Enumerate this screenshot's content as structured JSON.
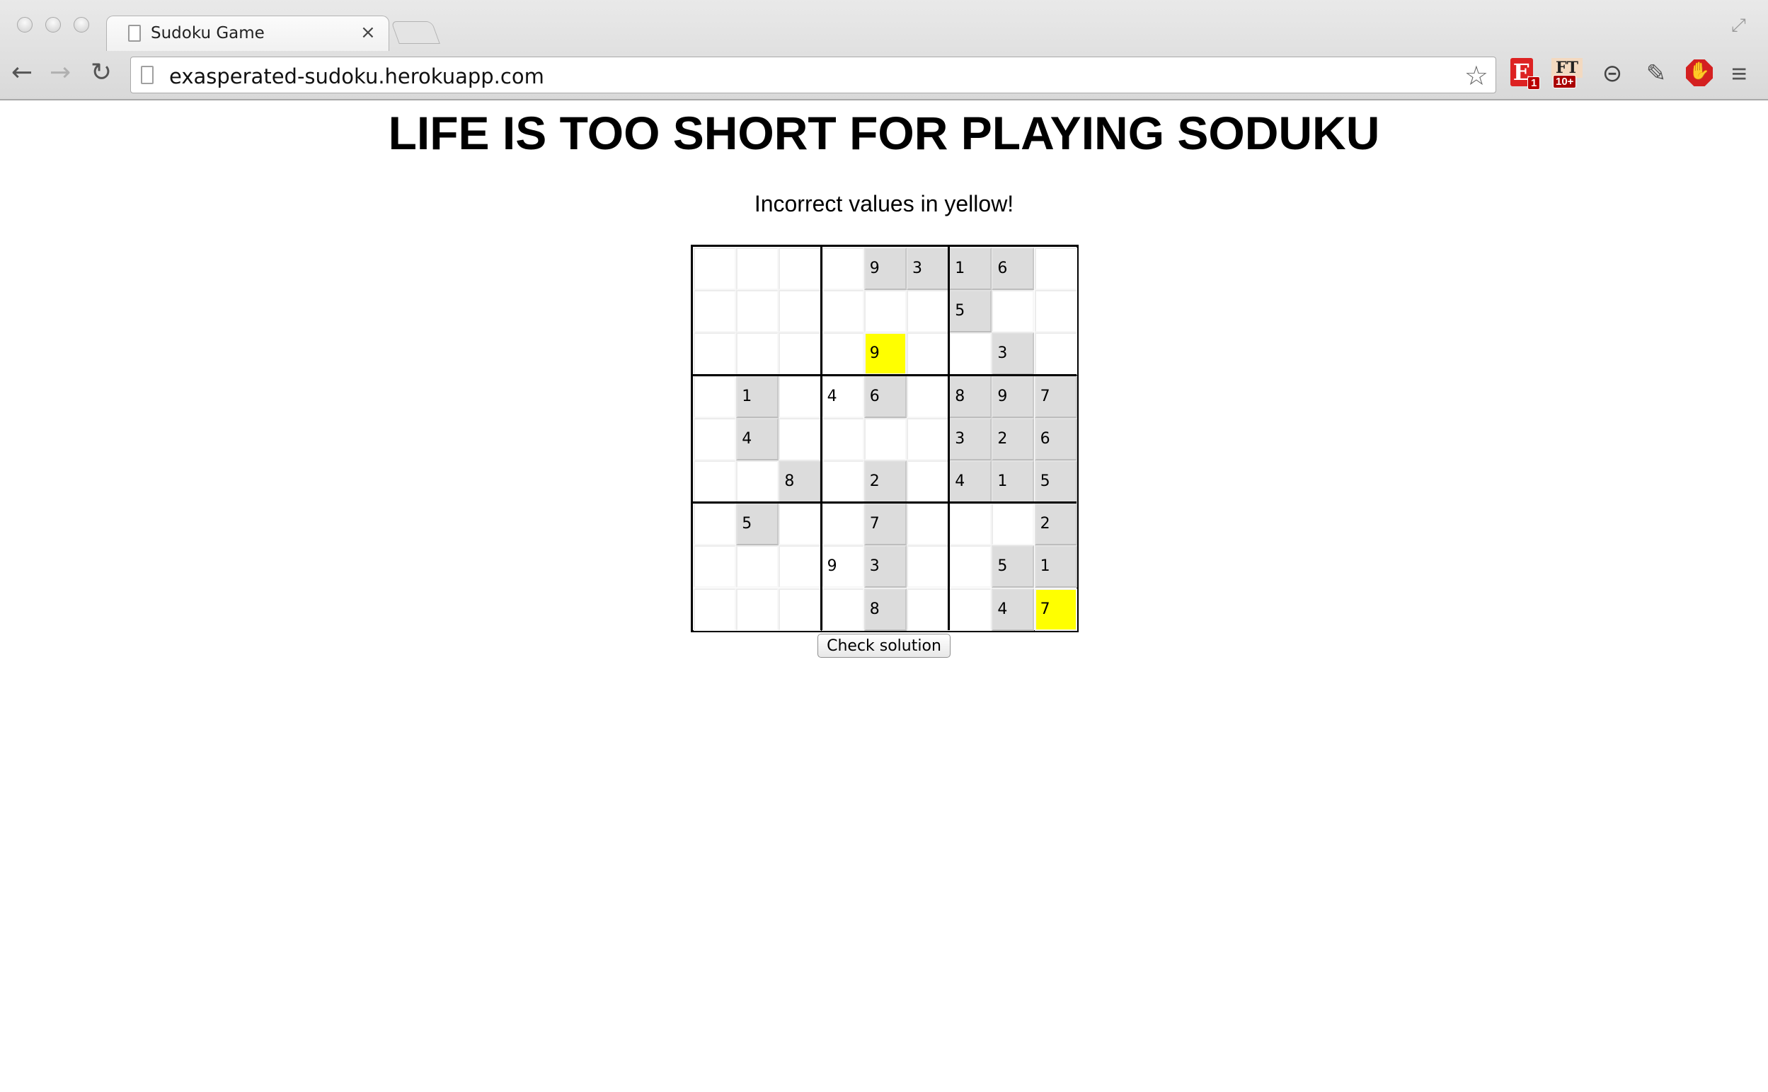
{
  "browser": {
    "tab_title": "Sudoku Game",
    "tab_close": "×",
    "url": "exasperated-sudoku.herokuapp.com",
    "extensions": {
      "evernote": {
        "letter": "E",
        "badge": "1"
      },
      "ft": {
        "label": "FT",
        "badge": "10+"
      }
    }
  },
  "page": {
    "title": "LIFE IS TOO SHORT FOR PLAYING SODUKU",
    "status": "Incorrect values in yellow!",
    "check_button": "Check solution"
  },
  "colors": {
    "given_cell": "#dcdcdc",
    "error_cell": "#ffff00",
    "empty_cell": "#ffffff"
  },
  "board": {
    "values": [
      [
        "",
        "",
        "",
        "",
        "9",
        "3",
        "1",
        "6",
        ""
      ],
      [
        "",
        "",
        "",
        "",
        "",
        "",
        "5",
        "",
        ""
      ],
      [
        "",
        "",
        "",
        "",
        "9",
        "",
        "",
        "3",
        ""
      ],
      [
        "",
        "1",
        "",
        "4",
        "6",
        "",
        "8",
        "9",
        "7"
      ],
      [
        "",
        "4",
        "",
        "",
        "",
        "",
        "3",
        "2",
        "6"
      ],
      [
        "",
        "",
        "8",
        "",
        "2",
        "",
        "4",
        "1",
        "5"
      ],
      [
        "",
        "5",
        "",
        "",
        "7",
        "",
        "",
        "",
        "2"
      ],
      [
        "",
        "",
        "",
        "9",
        "3",
        "",
        "",
        "5",
        "1"
      ],
      [
        "",
        "",
        "",
        "",
        "8",
        "",
        "",
        "4",
        "7"
      ]
    ],
    "states": [
      [
        "empty",
        "empty",
        "empty",
        "empty",
        "given",
        "given",
        "given",
        "given",
        "empty"
      ],
      [
        "empty",
        "empty",
        "empty",
        "empty",
        "empty",
        "empty",
        "given",
        "empty",
        "empty"
      ],
      [
        "empty",
        "empty",
        "empty",
        "empty",
        "error",
        "empty",
        "empty",
        "given",
        "empty"
      ],
      [
        "empty",
        "given",
        "empty",
        "entered",
        "given",
        "empty",
        "given",
        "given",
        "given"
      ],
      [
        "empty",
        "given",
        "empty",
        "empty",
        "empty",
        "empty",
        "given",
        "given",
        "given"
      ],
      [
        "empty",
        "empty",
        "given",
        "empty",
        "given",
        "empty",
        "given",
        "given",
        "given"
      ],
      [
        "empty",
        "given",
        "empty",
        "empty",
        "given",
        "empty",
        "empty",
        "empty",
        "given"
      ],
      [
        "empty",
        "empty",
        "empty",
        "entered",
        "given",
        "empty",
        "empty",
        "given",
        "given"
      ],
      [
        "empty",
        "empty",
        "empty",
        "empty",
        "given",
        "empty",
        "empty",
        "given",
        "error"
      ]
    ]
  }
}
